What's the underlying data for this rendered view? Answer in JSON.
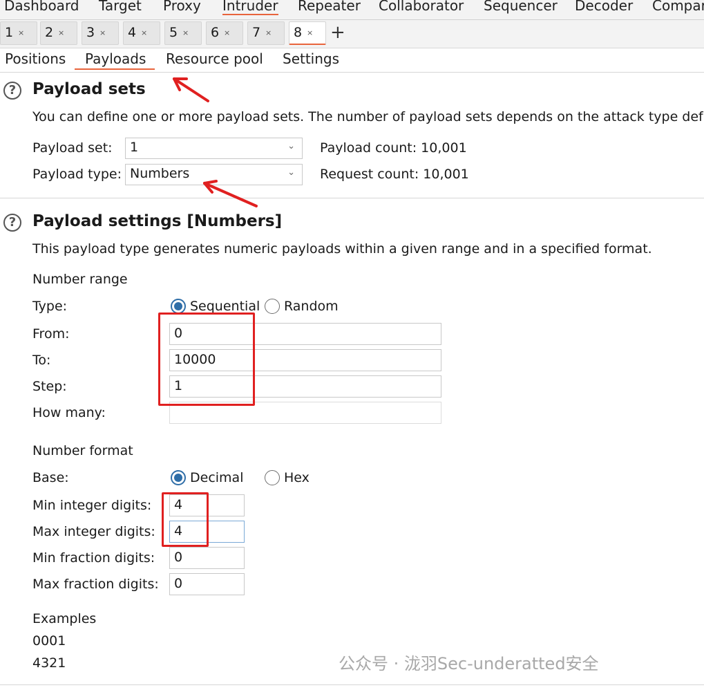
{
  "top_nav": [
    "Dashboard",
    "Target",
    "Proxy",
    "Intruder",
    "Repeater",
    "Collaborator",
    "Sequencer",
    "Decoder",
    "Compar"
  ],
  "top_nav_active": "Intruder",
  "instance_tabs": [
    "1",
    "2",
    "3",
    "4",
    "5",
    "6",
    "7",
    "8"
  ],
  "instance_tab_close": "×",
  "instance_tab_active": "8",
  "add_tab_label": "+",
  "sub_tabs": [
    "Positions",
    "Payloads",
    "Resource pool",
    "Settings"
  ],
  "sub_tab_active": "Payloads",
  "payload_sets": {
    "help_icon": "?",
    "title": "Payload sets",
    "description": "You can define one or more payload sets. The number of payload sets depends on the attack type def",
    "set_label": "Payload set:",
    "set_value": "1",
    "type_label": "Payload type:",
    "type_value": "Numbers",
    "payload_count": "Payload count: 10,001",
    "request_count": "Request count: 10,001",
    "chevron": "⌄"
  },
  "payload_settings": {
    "help_icon": "?",
    "title": "Payload settings [Numbers]",
    "description": "This payload type generates numeric payloads within a given range and in a specified format.",
    "number_range_heading": "Number range",
    "type_label": "Type:",
    "type_options": [
      "Sequential",
      "Random"
    ],
    "type_selected": "Sequential",
    "from_label": "From:",
    "from_value": "0",
    "to_label": "To:",
    "to_value": "10000",
    "step_label": "Step:",
    "step_value": "1",
    "how_many_label": "How many:",
    "how_many_value": "",
    "number_format_heading": "Number format",
    "base_label": "Base:",
    "base_options": [
      "Decimal",
      "Hex"
    ],
    "base_selected": "Decimal",
    "min_int_label": "Min integer digits:",
    "min_int_value": "4",
    "max_int_label": "Max integer digits:",
    "max_int_value": "4",
    "min_frac_label": "Min fraction digits:",
    "min_frac_value": "0",
    "max_frac_label": "Max fraction digits:",
    "max_frac_value": "0",
    "examples_heading": "Examples",
    "examples": [
      "0001",
      "4321"
    ]
  },
  "watermark": "公众号 · 泷羽Sec-underatted安全",
  "colors": {
    "accent": "#e8643c",
    "annotation": "#e02020",
    "radio": "#2f6ea8"
  }
}
